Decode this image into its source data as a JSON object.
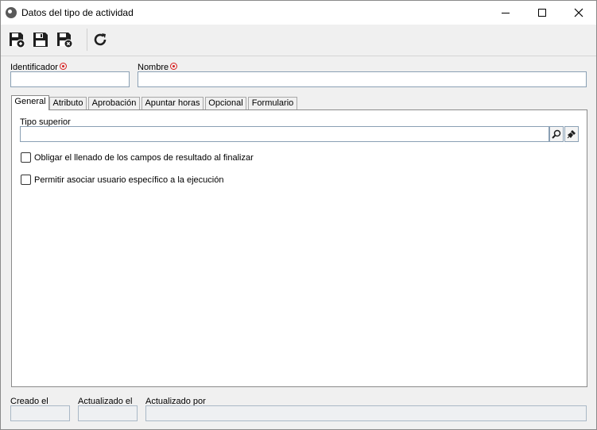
{
  "window": {
    "title": "Datos del tipo de actividad"
  },
  "toolbar": {
    "buttons": [
      {
        "icon": "save-new-icon"
      },
      {
        "icon": "save-icon"
      },
      {
        "icon": "save-close-icon"
      },
      {
        "icon": "refresh-icon"
      }
    ]
  },
  "form": {
    "identificador_label": "Identificador",
    "identificador_value": "",
    "nombre_label": "Nombre",
    "nombre_value": ""
  },
  "tabs": [
    {
      "label": "General",
      "active": true
    },
    {
      "label": "Atributo",
      "active": false
    },
    {
      "label": "Aprobación",
      "active": false
    },
    {
      "label": "Apuntar horas",
      "active": false
    },
    {
      "label": "Opcional",
      "active": false
    },
    {
      "label": "Formulario",
      "active": false
    }
  ],
  "general": {
    "tipo_superior_label": "Tipo superior",
    "tipo_superior_value": "",
    "checkbox1_label": "Obligar el llenado de los campos de resultado al finalizar",
    "checkbox1_checked": false,
    "checkbox2_label": "Permitir asociar usuario específico a la ejecución",
    "checkbox2_checked": false
  },
  "footer": {
    "creado_label": "Creado el",
    "creado_value": "",
    "actualizado_label": "Actualizado el",
    "actualizado_value": "",
    "actualizado_por_label": "Actualizado por",
    "actualizado_por_value": ""
  },
  "colors": {
    "required": "#d81e1e",
    "field_border": "#8aa0b4"
  }
}
